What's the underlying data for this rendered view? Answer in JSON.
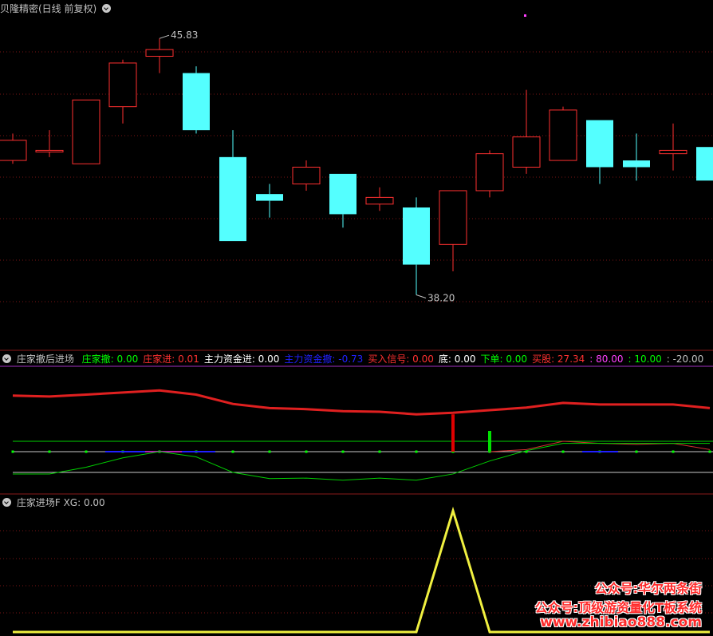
{
  "main_panel": {
    "title": "贝隆精密(日线 前复权)",
    "high_label": "45.83",
    "low_label": "38.20",
    "up_color": "#ff3030",
    "down_color": "#54ffff"
  },
  "indicator_panel": {
    "title": "庄家撤后进场",
    "fields": [
      {
        "label": "庄家撤:",
        "value": "0.00",
        "color": "#00ff00"
      },
      {
        "label": "庄家进:",
        "value": "0.01",
        "color": "#ff3030"
      },
      {
        "label": "主力资金进:",
        "value": "0.00",
        "color": "#ffffff"
      },
      {
        "label": "主力资金撤:",
        "value": "-0.73",
        "color": "#2020ff"
      },
      {
        "label": "买入信号:",
        "value": "0.00",
        "color": "#ff3030"
      },
      {
        "label": "底:",
        "value": "0.00",
        "color": "#ffffff"
      },
      {
        "label": "下单:",
        "value": "0.00",
        "color": "#00ff00"
      },
      {
        "label": "买股:",
        "value": "27.34",
        "color": "#ff3030"
      },
      {
        "label": ":",
        "value": "80.00",
        "color": "#ff40ff"
      },
      {
        "label": ":",
        "value": "10.00",
        "color": "#00ff00"
      },
      {
        "label": ":",
        "value": "-20.00",
        "color": "#c0c0c0"
      }
    ]
  },
  "xg_panel": {
    "title": "庄家进场F",
    "field_label": "XG:",
    "field_value": "0.00"
  },
  "watermark": {
    "line1": "公众号:华尔两条街",
    "line2": "公众号:顶级游资量化T板系统",
    "line3": "www.zhibiao888.com"
  },
  "chart_data": {
    "type": "candlestick",
    "ylim": [
      37.0,
      46.5
    ],
    "candles": [
      {
        "o": 42.2,
        "c": 42.8,
        "h": 43.0,
        "l": 42.1
      },
      {
        "o": 42.5,
        "c": 42.5,
        "h": 43.1,
        "l": 42.3
      },
      {
        "o": 42.1,
        "c": 44.0,
        "h": 44.0,
        "l": 42.1
      },
      {
        "o": 43.8,
        "c": 45.1,
        "h": 45.2,
        "l": 43.3
      },
      {
        "o": 45.3,
        "c": 45.5,
        "h": 45.83,
        "l": 44.8
      },
      {
        "o": 44.8,
        "c": 43.1,
        "h": 45.0,
        "l": 43.0
      },
      {
        "o": 42.3,
        "c": 39.8,
        "h": 43.1,
        "l": 39.8
      },
      {
        "o": 41.2,
        "c": 41.0,
        "h": 41.5,
        "l": 40.5
      },
      {
        "o": 41.5,
        "c": 42.0,
        "h": 42.2,
        "l": 41.3
      },
      {
        "o": 41.8,
        "c": 40.6,
        "h": 41.8,
        "l": 40.2
      },
      {
        "o": 40.9,
        "c": 41.1,
        "h": 41.4,
        "l": 40.7
      },
      {
        "o": 40.8,
        "c": 39.1,
        "h": 41.1,
        "l": 38.2
      },
      {
        "o": 39.7,
        "c": 41.3,
        "h": 41.3,
        "l": 38.9
      },
      {
        "o": 41.3,
        "c": 42.4,
        "h": 42.5,
        "l": 41.1
      },
      {
        "o": 42.0,
        "c": 42.9,
        "h": 44.3,
        "l": 41.8
      },
      {
        "o": 42.2,
        "c": 43.7,
        "h": 43.8,
        "l": 42.2
      },
      {
        "o": 43.4,
        "c": 42.0,
        "h": 43.4,
        "l": 41.5
      },
      {
        "o": 42.2,
        "c": 42.0,
        "h": 43.0,
        "l": 41.6
      },
      {
        "o": 42.4,
        "c": 42.5,
        "h": 43.3,
        "l": 41.9
      },
      {
        "o": 42.6,
        "c": 41.6,
        "h": 42.6,
        "l": 41.6
      }
    ],
    "thick_red_line": [
      54,
      53.2,
      55,
      57,
      59,
      55,
      46,
      42,
      41,
      39,
      38.5,
      36,
      37.5,
      40,
      42.5,
      47,
      45.5,
      45.5,
      45.5,
      42
    ],
    "green_line": [
      -21.5,
      -21.5,
      -15,
      -6,
      0,
      -5,
      -20,
      -26,
      -25.5,
      -27.5,
      -25.5,
      -27.5,
      -21.5,
      -9,
      1,
      8,
      8,
      8,
      8,
      8
    ],
    "thin_red_line": [
      null,
      null,
      null,
      null,
      null,
      null,
      null,
      null,
      null,
      null,
      null,
      null,
      null,
      0,
      2,
      10,
      8,
      7,
      8,
      2
    ],
    "xg_values": [
      0,
      0,
      0,
      0,
      0,
      0,
      0,
      0,
      0,
      0,
      0,
      0,
      1,
      0,
      0,
      0,
      0,
      0,
      0,
      0
    ]
  }
}
